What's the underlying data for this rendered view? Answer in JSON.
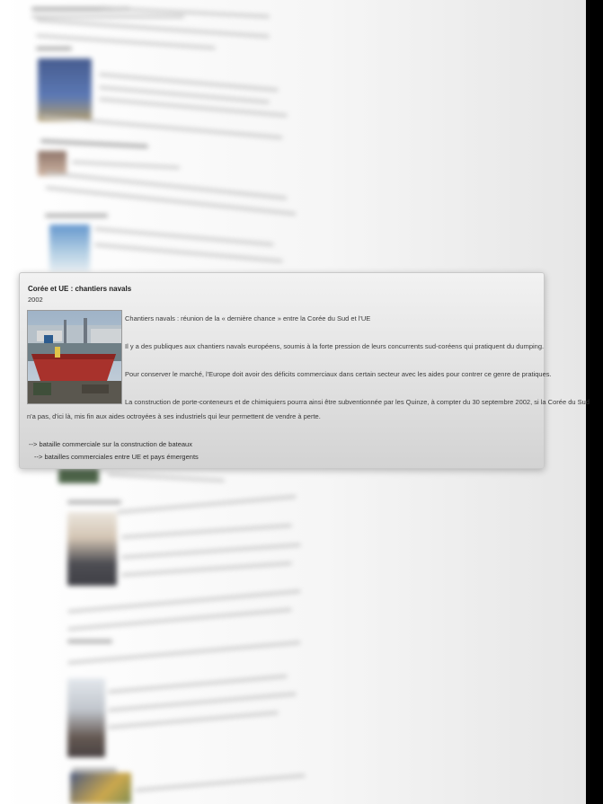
{
  "popup": {
    "title": "Corée et UE : chantiers navals",
    "year": "2002",
    "photo": "shipyard-photo",
    "paragraphs": [
      "Chantiers navals : réunion de la « dernière chance » entre la Corée du Sud et l'UE",
      "Il y a des publiques aux chantiers navals européens, soumis à la forte pression de leurs concurrents sud-coréens qui pratiquent du dumping.",
      "Pour conserver le marché, l'Europe doit avoir des déficits commerciaux dans certain secteur avec les aides pour contrer ce genre de pratiques.",
      "La construction de porte-conteneurs et de chimiquiers pourra ainsi être subventionnée par les Quinze, à compter du 30 septembre 2002, si la Corée du Sud",
      "n'a pas, d'ici là, mis fin aux aides octroyées à ses industriels qui leur permettent de vendre à perte."
    ],
    "links": [
      "--> bataille commerciale sur la construction de bateaux",
      "--> batailles commerciales entre UE et pays émergents"
    ]
  },
  "colors": {
    "card_top": "#f2f2f2",
    "card_bottom": "#d3d3d3",
    "right_bar": "#000000"
  }
}
